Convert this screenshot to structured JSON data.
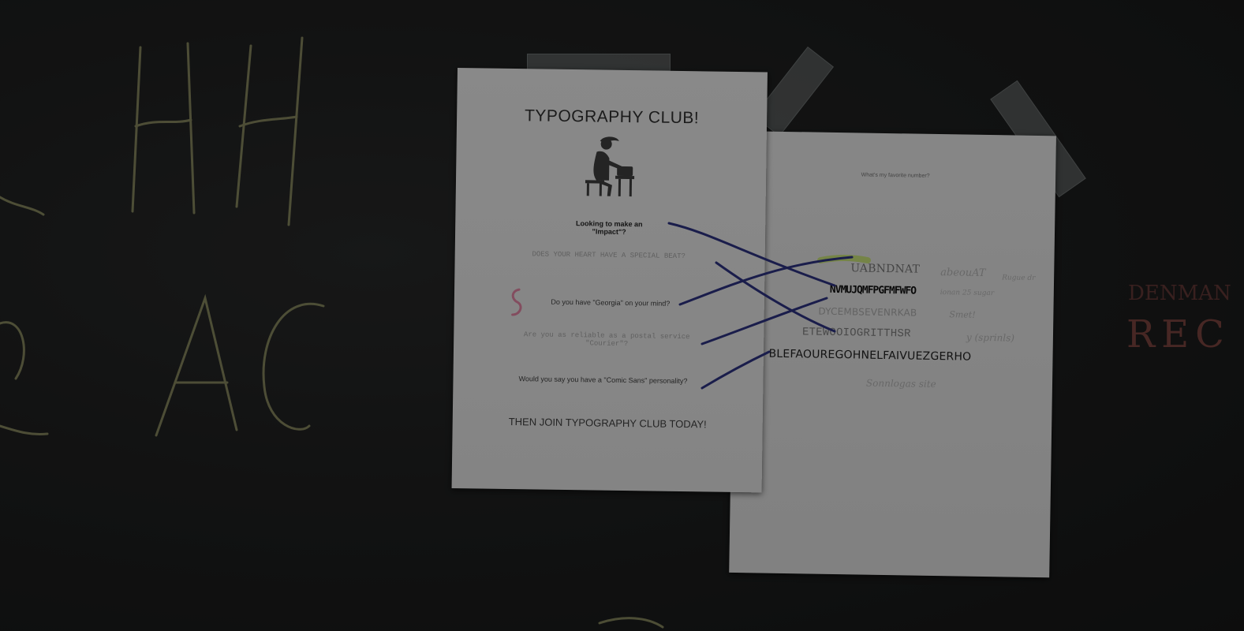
{
  "chalkboard": {
    "left_letters": "HH",
    "left_letters_bottom": "AC",
    "right_word_upper": "DENMAN",
    "right_word_lower": "REC"
  },
  "poster": {
    "title": "TYPOGRAPHY CLUB!",
    "questions": [
      "Looking to make an \"Impact\"?",
      "DOES YOUR HEART HAVE A SPECIAL BEAT?",
      "Do you have \"Georgia\" on your mind?",
      "Are you as reliable as a postal service \"Courier\"?",
      "Would you say you have a \"Comic Sans\" personality?"
    ],
    "call_to_action": "THEN JOIN TYPOGRAPHY CLUB TODAY!"
  },
  "cipher_sheet": {
    "heading": "What's my favorite number?",
    "ciphers": [
      "UABNDNAT",
      "NVMUJQMFPGFMFWFO",
      "DYCEMBSEVENRKAB",
      "ETEWOOIOGRITTHSR",
      "BLEFAOUREGOHNELFAIVUEZGERHO"
    ],
    "handwritten_notes": [
      "abeouAT",
      "Rugue dr",
      "ionan 25 sugar",
      "Smet!",
      "y (sprinls)",
      "Sonnlogas site"
    ]
  },
  "colors": {
    "board": "#1b1c1c",
    "paper": "#dcdcdc",
    "marker_blue": "#2a2f7a",
    "highlight_green": "#b6d65a",
    "chalk_yellow": "#c8c98a",
    "chalk_red": "#b65a55"
  }
}
